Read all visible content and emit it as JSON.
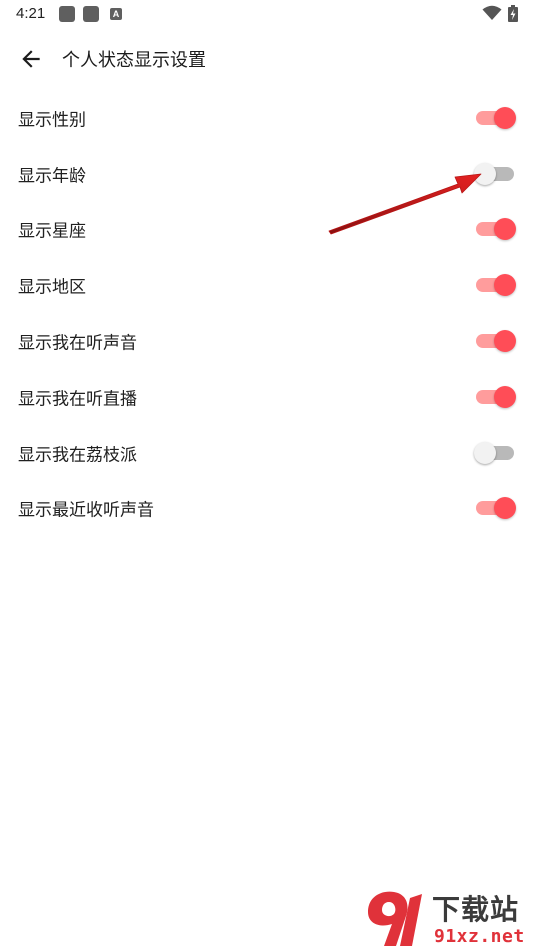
{
  "status_bar": {
    "time": "4:21",
    "notification_icons": [
      "app-notification-icon",
      "app-notification-icon",
      "a-notification-icon"
    ],
    "a_icon_letter": "A"
  },
  "app_bar": {
    "title": "个人状态显示设置",
    "back_icon": "arrow-back-icon"
  },
  "settings": [
    {
      "label": "显示性别",
      "enabled": true
    },
    {
      "label": "显示年龄",
      "enabled": false
    },
    {
      "label": "显示星座",
      "enabled": true
    },
    {
      "label": "显示地区",
      "enabled": true
    },
    {
      "label": "显示我在听声音",
      "enabled": true
    },
    {
      "label": "显示我在听直播",
      "enabled": true
    },
    {
      "label": "显示我在荔枝派",
      "enabled": false
    },
    {
      "label": "显示最近收听声音",
      "enabled": true
    }
  ],
  "colors": {
    "switch_on_thumb": "#ff4d57",
    "switch_on_track": "#ff9c9c",
    "switch_off_thumb": "#f2f2f2",
    "switch_off_track": "#b9b9b9",
    "annotation_arrow": "#d81e1e"
  },
  "watermark": {
    "cn_text": "下载站",
    "url_text": "91xz.net"
  }
}
